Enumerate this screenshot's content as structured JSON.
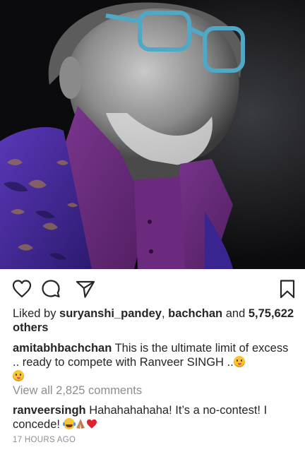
{
  "post": {
    "likes": {
      "prefix": "Liked by ",
      "user1": "suryanshi_pandey",
      "sep": ", ",
      "user2": "bachchan",
      "and": " and ",
      "count": "5,75,622 others"
    },
    "caption": {
      "username": "amitabhbachchan",
      "text": " This is the ultimate limit of excess .. ready to compete with Ranveer SINGH .."
    },
    "view_comments": "View all 2,825 comments",
    "reply": {
      "username": "ranveersingh",
      "text": " Hahahahahaha! It’s a no-contest! I concede! "
    },
    "timestamp": "17 HOURS AGO"
  },
  "icons": {
    "like": "heart-icon",
    "comment": "comment-icon",
    "share": "share-icon",
    "save": "bookmark-icon"
  },
  "colors": {
    "text": "#262626",
    "muted": "#8e8e8e",
    "shirt": "#6a2a78",
    "jacket": "#4b2ba0",
    "glasses": "#4fa9c6"
  }
}
